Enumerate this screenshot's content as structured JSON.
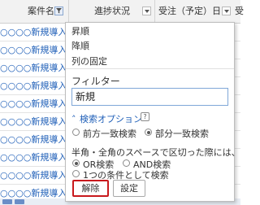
{
  "grid": {
    "columns": [
      {
        "label": "案件名",
        "has_filter": true
      },
      {
        "label": "進捗状況",
        "has_filter": false
      },
      {
        "label": "受注（予定）日",
        "has_filter": false
      },
      {
        "label": "受",
        "has_filter": false
      }
    ],
    "rows": [
      "○○○○新規導入",
      "○○○○新規導入",
      "○○○○新規導入",
      "○○○○新規導入",
      "○○○○新規導入",
      "○○○○新規導入",
      "○○○○新規導入",
      "○○○○新規導入",
      "○○○○新規導入",
      "○○○○新規導入"
    ]
  },
  "popup": {
    "menu": {
      "sort_asc": "昇順",
      "sort_desc": "降順",
      "freeze_column": "列の固定"
    },
    "filter_title": "フィルター",
    "filter_value": "新規",
    "search_options_label": "検索オプション",
    "help_icon_text": "?",
    "match_mode": {
      "prefix_label": "前方一致検索",
      "partial_label": "部分一致検索",
      "selected": "partial"
    },
    "space_note": "半角・全角のスペースで区切った際には、",
    "logic": {
      "or_label": "OR検索",
      "and_label": "AND検索",
      "single_label": "1つの条件として検索",
      "selected": "or"
    },
    "buttons": {
      "clear": "解除",
      "apply": "設定"
    }
  },
  "colors": {
    "link": "#1f5fb8",
    "highlight_border": "#c8191d"
  }
}
